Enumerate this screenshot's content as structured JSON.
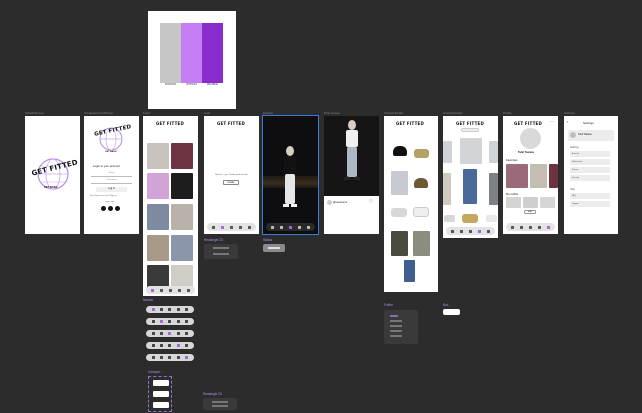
{
  "palette": {
    "swatches": [
      {
        "label": "#C8C8C8",
        "color": "#c6c6c6"
      },
      {
        "label": "#C57EF3",
        "color": "#c57ef3"
      },
      {
        "label": "#8A2BCE",
        "color": "#8a2bce"
      }
    ]
  },
  "frames": {
    "labels": [
      "SplashScreen",
      "CreateAccountScreen",
      "Feed",
      "Lists",
      "Explore",
      "Post screen",
      "Closet/Upload",
      "Closet/Upload",
      "Profile",
      "Settings"
    ],
    "logo": "GET FITTED",
    "splash_tag": "GET BASIC",
    "account": {
      "tag": "GET BASIC",
      "heading": "Login to your account",
      "field_email": "Email",
      "field_password": "Password",
      "login_btn": "Log in",
      "forgot": "Don't have an account? Sign up",
      "or_label": "Login with"
    },
    "lists": {
      "empty_text": "No lists... yet. Create your first list",
      "btn": "Create"
    },
    "post": {
      "user": "@username"
    },
    "profile": {
      "name": "Tanil Tsatsas",
      "section": "Favorites",
      "outfits": "My outfits",
      "btn": "Edit"
    },
    "settings": {
      "title": "Settings",
      "user": "Tanil Tsatsas",
      "section1": "Settings",
      "section2": "Help",
      "rows": [
        "Account",
        "Notifications",
        "Privacy",
        "Security"
      ],
      "rows2": [
        "FAQ",
        "Support"
      ]
    }
  },
  "components": {
    "rect23": "Rectangle 23",
    "rect23b": "Rectangle 23",
    "navbar_label": "Navbar",
    "comp_label": "Compon...",
    "status_label": "Status",
    "folder_label": "Folder",
    "button_label": "But..."
  },
  "colors": {
    "accent": "#9b6bd8",
    "canvas": "#2c2c2c"
  }
}
